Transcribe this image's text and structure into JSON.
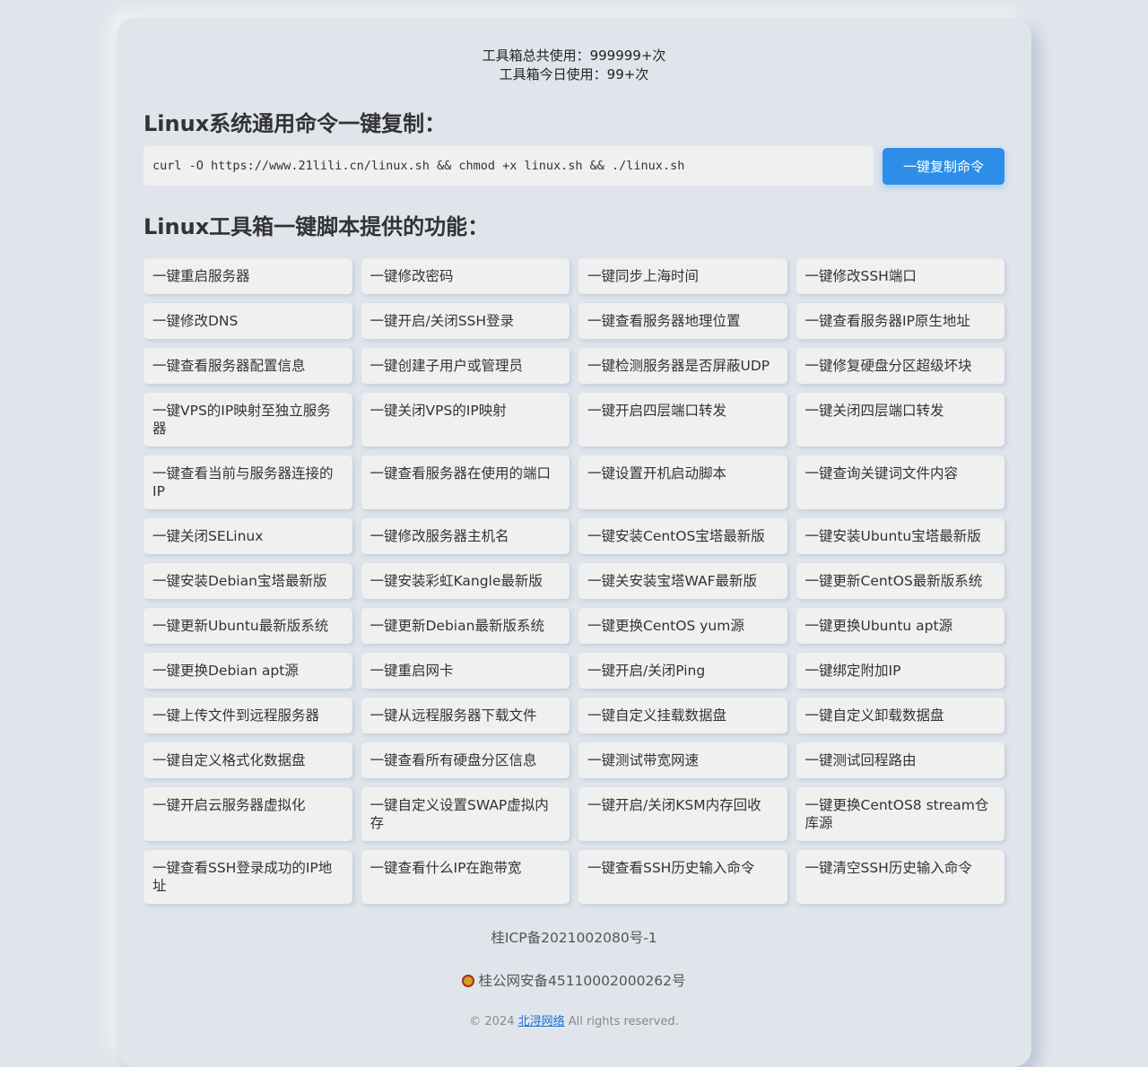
{
  "stats": {
    "total_label": "工具箱总共使用：",
    "total_value": "999999+次",
    "today_label": "工具箱今日使用：",
    "today_value": "99+次"
  },
  "command_section": {
    "heading": "Linux系统通用命令一键复制：",
    "command": "curl -O https://www.21lili.cn/linux.sh && chmod +x linux.sh && ./linux.sh",
    "copy_button": "一键复制命令"
  },
  "features_section": {
    "heading": "Linux工具箱一键脚本提供的功能：",
    "rows": [
      [
        "一键重启服务器",
        "一键修改密码",
        "一键同步上海时间",
        "一键修改SSH端口"
      ],
      [
        "一键修改DNS",
        "一键开启/关闭SSH登录",
        "一键查看服务器地理位置",
        "一键查看服务器IP原生地址"
      ],
      [
        "一键查看服务器配置信息",
        "一键创建子用户或管理员",
        "一键检测服务器是否屏蔽UDP",
        "一键修复硬盘分区超级坏块"
      ],
      [
        "一键VPS的IP映射至独立服务器",
        "一键关闭VPS的IP映射",
        "一键开启四层端口转发",
        "一键关闭四层端口转发"
      ],
      [
        "一键查看当前与服务器连接的IP",
        "一键查看服务器在使用的端口",
        "一键设置开机启动脚本",
        "一键查询关键词文件内容"
      ],
      [
        "一键关闭SELinux",
        "一键修改服务器主机名",
        "一键安装CentOS宝塔最新版",
        "一键安装Ubuntu宝塔最新版"
      ],
      [
        "一键安装Debian宝塔最新版",
        "一键安装彩虹Kangle最新版",
        "一键关安装宝塔WAF最新版",
        "一键更新CentOS最新版系统"
      ],
      [
        "一键更新Ubuntu最新版系统",
        "一键更新Debian最新版系统",
        "一键更换CentOS yum源",
        "一键更换Ubuntu apt源"
      ],
      [
        "一键更换Debian apt源",
        "一键重启网卡",
        "一键开启/关闭Ping",
        "一键绑定附加IP"
      ],
      [
        "一键上传文件到远程服务器",
        "一键从远程服务器下载文件",
        "一键自定义挂载数据盘",
        "一键自定义卸载数据盘"
      ],
      [
        "一键自定义格式化数据盘",
        "一键查看所有硬盘分区信息",
        "一键测试带宽网速",
        "一键测试回程路由"
      ],
      [
        "一键开启云服务器虚拟化",
        "一键自定义设置SWAP虚拟内存",
        "一键开启/关闭KSM内存回收",
        "一键更换CentOS8 stream仓库源"
      ],
      [
        "一键查看SSH登录成功的IP地址",
        "一键查看什么IP在跑带宽",
        "一键查看SSH历史输入命令",
        "一键清空SSH历史输入命令"
      ]
    ]
  },
  "footer": {
    "icp": "桂ICP备2021002080号-1",
    "police_icon": "police-badge-icon",
    "police": "桂公网安备45110002000262号",
    "copyright_prefix": "© 2024",
    "company": "北浔网络",
    "copyright_suffix": "All rights reserved."
  },
  "colors": {
    "background": "#e0e5ec",
    "button": "#2c8ee6",
    "item_bg": "#f0f0f0",
    "link": "#1a6fd1"
  }
}
